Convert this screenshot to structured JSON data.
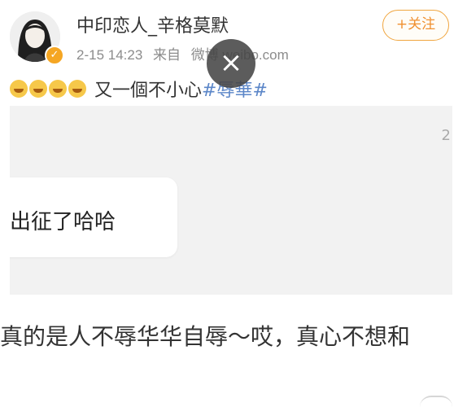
{
  "user": {
    "name": "中印恋人_辛格莫默",
    "date": "2-15 14:23",
    "source_prefix": "来自",
    "source": "微博 weibo.com",
    "follow_label": "+关注"
  },
  "post": {
    "emojis": [
      "laugh-cry-emoji",
      "laugh-cry-emoji",
      "laugh-cry-emoji",
      "laugh-cry-emoji"
    ],
    "text": "又一個不小心",
    "hashtag": "#辱華#"
  },
  "media": {
    "edge_digit": "2",
    "bubble_text": "出征了哈哈"
  },
  "caption": "真的是人不辱华华自辱～哎，真心不想和",
  "colors": {
    "accent": "#f09030",
    "link": "#5b86c8",
    "verified": "#f5a623"
  }
}
